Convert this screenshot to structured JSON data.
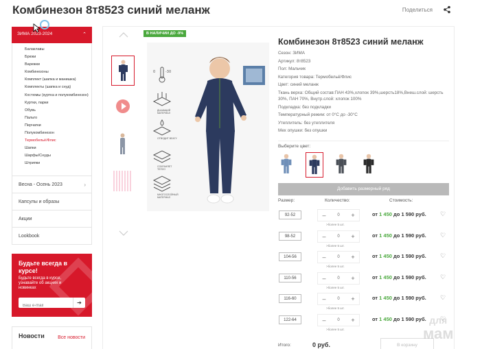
{
  "page": {
    "title": "Комбинезон 8т8523 синий меланж",
    "share_label": "Поделиться",
    "icons": {
      "share": "share-icon"
    }
  },
  "sidebar": {
    "active_category": "ЗИМА 2023-2024",
    "subcategories": [
      {
        "label": "Балаклавы"
      },
      {
        "label": "Брюки"
      },
      {
        "label": "Варежки"
      },
      {
        "label": "Комбинезоны"
      },
      {
        "label": "Комплект (шапка и манишка)"
      },
      {
        "label": "Комплекты (шапка и снуд)"
      },
      {
        "label": "Костюмы (куртка и полукомбинезон)"
      },
      {
        "label": "Куртки, парки"
      },
      {
        "label": "Обувь"
      },
      {
        "label": "Пальто"
      },
      {
        "label": "Перчатки"
      },
      {
        "label": "Полукомбинезон"
      },
      {
        "label": "Термобельё/Флис",
        "active": true
      },
      {
        "label": "Шапки"
      },
      {
        "label": "Шарфы/Снуды"
      },
      {
        "label": "Штрипки"
      }
    ],
    "menu": [
      {
        "label": "Весна - Осень 2023",
        "has_arrow": true
      },
      {
        "label": "Капсулы и образы"
      },
      {
        "label": "Акции"
      },
      {
        "label": "Lookbook"
      }
    ]
  },
  "promo": {
    "title": "Будьте всегда в курсе!",
    "text": "Будьте всегда в курсе, узнавайте об акциях и новинках",
    "email_placeholder": "Ваш e-mail",
    "submit_icon": "arrow-right-icon"
  },
  "news": {
    "title": "Новости",
    "all_link": "Все новости"
  },
  "gallery": {
    "badge": "В НАЛИЧИИ ДО -9%",
    "features": [
      {
        "label": "ДЫШАЩИЙ МАТЕРИАЛ"
      },
      {
        "label": "ОТВОДИТ ВЛАГУ"
      },
      {
        "label": "СОХРАНЯЕТ ТЕПЛО"
      },
      {
        "label": "МНОГОСЛОЙНЫЙ МАТЕРИАЛ"
      }
    ]
  },
  "product": {
    "title": "Комбинезон 8т8523 синий меланж",
    "specs": [
      "Сезон: ЗИМА",
      "Артикул: 8т8523",
      "Пол: Мальчик",
      "Категория товара: Термобельё/Флис",
      "Цвет: синий меланж",
      "Ткань верха: Общий состав:ПАН 43%,хлопок 39%,шерсть18%,Внеш.слой: шерсть 30%, ПАН 70%, Внутр.слой: хлопок 100%",
      "Подкладка: без подкладки",
      "Температурный режим: от 0°С до -30°С",
      "Утеплитель: без утеплителя",
      "Мех опушки: без опушки"
    ],
    "color_label": "Выберите цвет:",
    "colors": [
      {
        "color": "#6f8fb8",
        "selected": false
      },
      {
        "color": "#2c3a5e",
        "selected": true
      },
      {
        "color": "#4a4f57",
        "selected": false
      },
      {
        "color": "#2b2b2b",
        "selected": false
      }
    ],
    "size_chart_button": "Добавить размерный ряд",
    "table_headers": {
      "size": "Размер:",
      "qty": "Количество:",
      "price": "Стоимость:"
    },
    "rows": [
      {
        "size": "92-52",
        "qty": "0",
        "hint": ">более 5 шт.",
        "price_from": "от ",
        "price_green": "1 450",
        "price_rest": " до 1 590 руб."
      },
      {
        "size": "98-52",
        "qty": "0",
        "hint": ">более 5 шт.",
        "price_from": "от ",
        "price_green": "1 450",
        "price_rest": " до 1 590 руб."
      },
      {
        "size": "104-56",
        "qty": "0",
        "hint": ">более 5 шт.",
        "price_from": "от ",
        "price_green": "1 450",
        "price_rest": " до 1 590 руб."
      },
      {
        "size": "110-56",
        "qty": "0",
        "hint": ">более 5 шт.",
        "price_from": "от ",
        "price_green": "1 450",
        "price_rest": " до 1 590 руб."
      },
      {
        "size": "116-60",
        "qty": "0",
        "hint": ">более 5 шт.",
        "price_from": "от ",
        "price_green": "1 450",
        "price_rest": " до 1 590 руб."
      },
      {
        "size": "122-64",
        "qty": "0",
        "hint": ">более 5 шт.",
        "price_from": "от ",
        "price_green": "1 450",
        "price_rest": " до 1 590 руб."
      }
    ],
    "total_label": "Итого:",
    "total_value": "0 руб.",
    "cart_button": "В корзину"
  },
  "watermark": {
    "line1": "для",
    "line2": "мам"
  },
  "colors": {
    "brand_red": "#d7182a",
    "price_green": "#4aa83d",
    "button_grey": "#b9b9b9"
  }
}
